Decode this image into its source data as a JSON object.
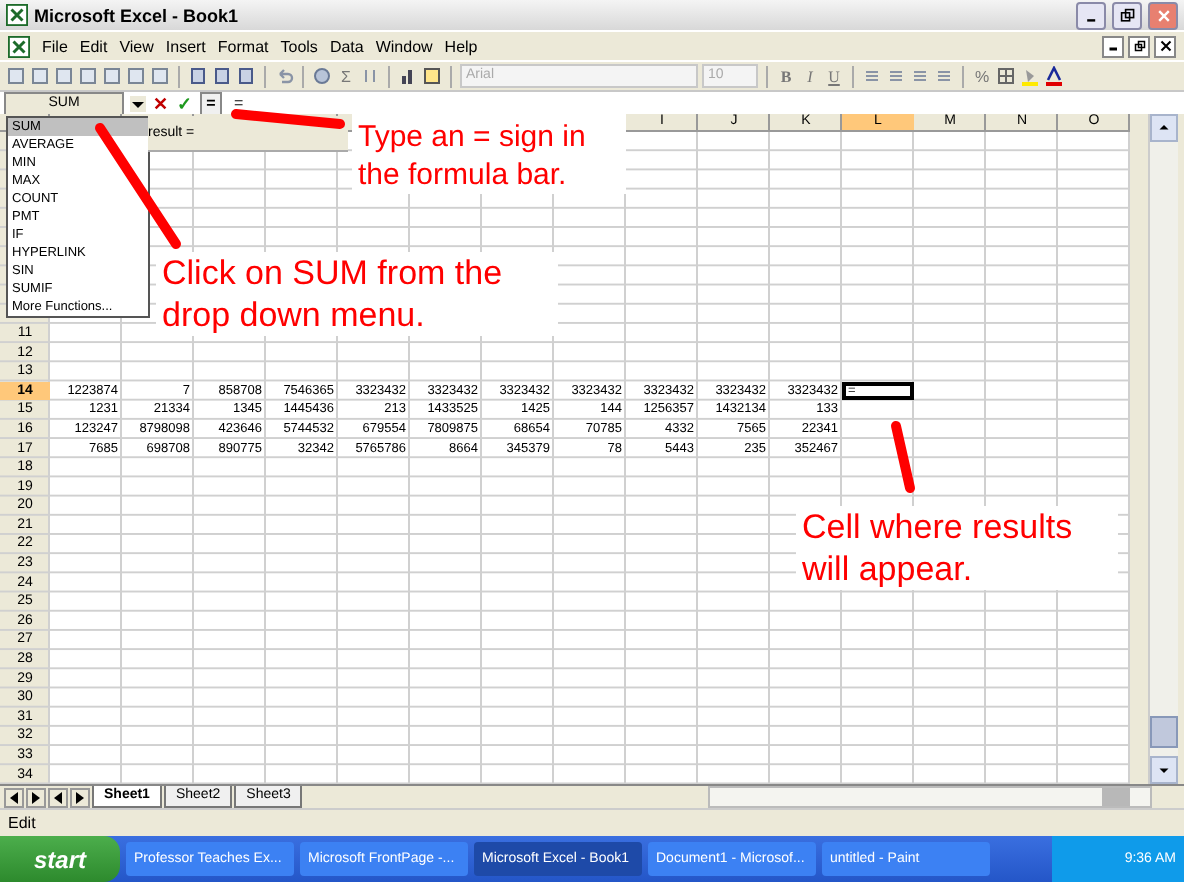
{
  "window": {
    "title": "Microsoft Excel - Book1"
  },
  "menu": [
    "File",
    "Edit",
    "View",
    "Insert",
    "Format",
    "Tools",
    "Data",
    "Window",
    "Help"
  ],
  "toolbar": {
    "sum": "Σ",
    "font": "Arial",
    "size": "10",
    "bold": "B",
    "italic": "I",
    "underline": "U",
    "percent": "%"
  },
  "formula_bar": {
    "name_box": "SUM",
    "cancel": "✕",
    "enter": "✓",
    "equals": "=",
    "formula": "="
  },
  "function_menu": [
    {
      "label": "SUM",
      "selected": true
    },
    {
      "label": "AVERAGE",
      "selected": false
    },
    {
      "label": "MIN",
      "selected": false
    },
    {
      "label": "MAX",
      "selected": false
    },
    {
      "label": "COUNT",
      "selected": false
    },
    {
      "label": "PMT",
      "selected": false
    },
    {
      "label": "IF",
      "selected": false
    },
    {
      "label": "HYPERLINK",
      "selected": false
    },
    {
      "label": "SIN",
      "selected": false
    },
    {
      "label": "SUMIF",
      "selected": false
    },
    {
      "label": "More Functions...",
      "selected": false
    }
  ],
  "result_tip": "result =",
  "column_headers": [
    {
      "label": "I",
      "selected": false
    },
    {
      "label": "J",
      "selected": false
    },
    {
      "label": "K",
      "selected": false
    },
    {
      "label": "L",
      "selected": true
    },
    {
      "label": "M",
      "selected": false
    },
    {
      "label": "N",
      "selected": false
    },
    {
      "label": "O",
      "selected": false
    }
  ],
  "rows": [
    {
      "label": "11",
      "selected": false,
      "cells": []
    },
    {
      "label": "12",
      "selected": false,
      "cells": []
    },
    {
      "label": "13",
      "selected": false,
      "cells": []
    },
    {
      "label": "14",
      "selected": true,
      "cells": [
        "1223874",
        "7",
        "858708",
        "7546365",
        "3323432",
        "3323432",
        "3323432",
        "3323432",
        "3323432",
        "3323432",
        "3323432"
      ],
      "active_cell": "="
    },
    {
      "label": "15",
      "selected": false,
      "cells": [
        "1231",
        "21334",
        "1345",
        "1445436",
        "213",
        "1433525",
        "1425",
        "144",
        "1256357",
        "1432134",
        "133"
      ]
    },
    {
      "label": "16",
      "selected": false,
      "cells": [
        "123247",
        "8798098",
        "423646",
        "5744532",
        "679554",
        "7809875",
        "68654",
        "70785",
        "4332",
        "7565",
        "22341"
      ]
    },
    {
      "label": "17",
      "selected": false,
      "cells": [
        "7685",
        "698708",
        "890775",
        "32342",
        "5765786",
        "8664",
        "345379",
        "78",
        "5443",
        "235",
        "352467"
      ]
    },
    {
      "label": "18",
      "selected": false,
      "cells": []
    },
    {
      "label": "19",
      "selected": false,
      "cells": []
    },
    {
      "label": "20",
      "selected": false,
      "cells": []
    },
    {
      "label": "21",
      "selected": false,
      "cells": []
    },
    {
      "label": "22",
      "selected": false,
      "cells": []
    },
    {
      "label": "23",
      "selected": false,
      "cells": []
    },
    {
      "label": "24",
      "selected": false,
      "cells": []
    },
    {
      "label": "25",
      "selected": false,
      "cells": []
    },
    {
      "label": "26",
      "selected": false,
      "cells": []
    },
    {
      "label": "27",
      "selected": false,
      "cells": []
    },
    {
      "label": "28",
      "selected": false,
      "cells": []
    },
    {
      "label": "29",
      "selected": false,
      "cells": []
    },
    {
      "label": "30",
      "selected": false,
      "cells": []
    },
    {
      "label": "31",
      "selected": false,
      "cells": []
    },
    {
      "label": "32",
      "selected": false,
      "cells": []
    },
    {
      "label": "33",
      "selected": false,
      "cells": []
    },
    {
      "label": "34",
      "selected": false,
      "cells": []
    }
  ],
  "sheet_tabs": [
    {
      "label": "Sheet1",
      "selected": true
    },
    {
      "label": "Sheet2",
      "selected": false
    },
    {
      "label": "Sheet3",
      "selected": false
    }
  ],
  "status_bar": "Edit",
  "callouts": [
    "Type an = sign in the formula bar.",
    "Click on SUM from the drop down menu.",
    "Cell where results will appear."
  ],
  "taskbar": {
    "start": "start",
    "items": [
      {
        "label": "Professor Teaches Ex...",
        "selected": false
      },
      {
        "label": "Microsoft FrontPage -...",
        "selected": false
      },
      {
        "label": "Microsoft Excel - Book1",
        "selected": true
      },
      {
        "label": "Document1 - Microsof...",
        "selected": false
      },
      {
        "label": "untitled - Paint",
        "selected": false
      }
    ],
    "clock": "9:36 AM"
  }
}
